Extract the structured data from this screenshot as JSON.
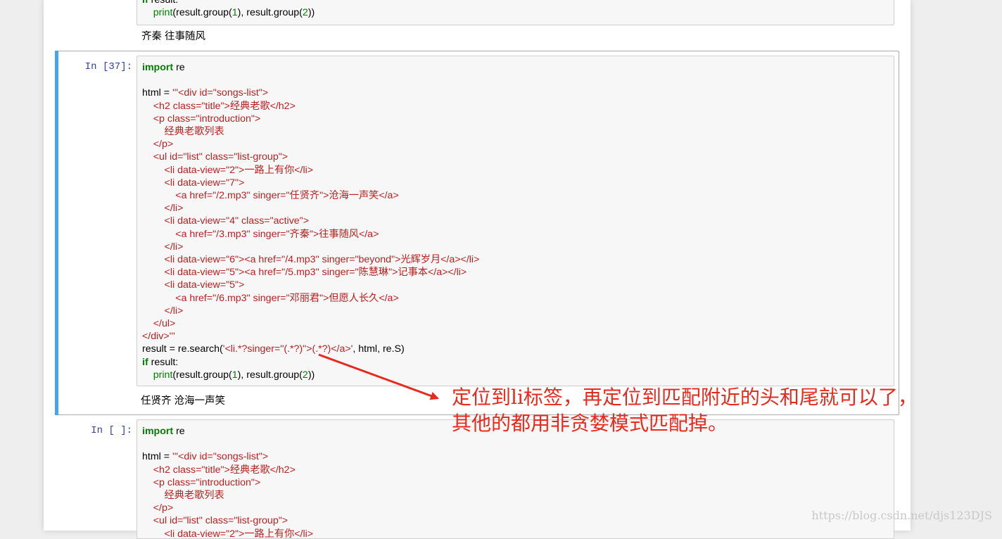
{
  "cells": {
    "prev": {
      "code_tail": [
        "if result:",
        "    print(result.group(1), result.group(2))"
      ],
      "output": "齐秦 往事随风"
    },
    "current": {
      "prompt": "In [37]:",
      "output": "任贤齐 沧海一声笑"
    },
    "next": {
      "prompt": "In [ ]:"
    }
  },
  "annotation": {
    "lines": [
      "定位到li标签，再定位到匹配附近的头和尾就可以了，",
      "其他的都用非贪婪模式匹配掉。"
    ],
    "color": "#e8291c"
  },
  "watermark": "https://blog.csdn.net/djs123DJS",
  "colors": {
    "keyword": "#008000",
    "string": "#ba2121",
    "prompt": "#303f9f",
    "selected_bar": "#42a5f5"
  }
}
